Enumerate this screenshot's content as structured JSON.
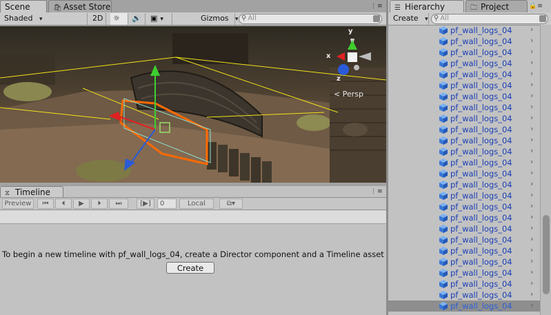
{
  "scene_tabs": {
    "scene": "Scene",
    "asset_store": "Asset Store"
  },
  "scene_toolbar": {
    "shading_mode": "Shaded",
    "view_2d": "2D",
    "gizmos": "Gizmos",
    "search_placeholder": "All"
  },
  "scene_view": {
    "projection_label": "Persp",
    "axis_y": "y",
    "axis_x": "x",
    "axis_z": "z"
  },
  "timeline": {
    "tab_label": "Timeline",
    "preview_label": "Preview",
    "frame_value": "0",
    "time_format": "Local",
    "message": "To begin a new timeline with pf_wall_logs_04, create a Director component and a Timeline asset",
    "create_button": "Create"
  },
  "hierarchy": {
    "tab_label": "Hierarchy",
    "project_tab_label": "Project",
    "create_label": "Create",
    "search_placeholder": "All",
    "items": [
      {
        "label": "pf_wall_logs_04"
      },
      {
        "label": "pf_wall_logs_04"
      },
      {
        "label": "pf_wall_logs_04"
      },
      {
        "label": "pf_wall_logs_04"
      },
      {
        "label": "pf_wall_logs_04"
      },
      {
        "label": "pf_wall_logs_04"
      },
      {
        "label": "pf_wall_logs_04"
      },
      {
        "label": "pf_wall_logs_04"
      },
      {
        "label": "pf_wall_logs_04"
      },
      {
        "label": "pf_wall_logs_04"
      },
      {
        "label": "pf_wall_logs_04"
      },
      {
        "label": "pf_wall_logs_04"
      },
      {
        "label": "pf_wall_logs_04"
      },
      {
        "label": "pf_wall_logs_04"
      },
      {
        "label": "pf_wall_logs_04"
      },
      {
        "label": "pf_wall_logs_04"
      },
      {
        "label": "pf_wall_logs_04"
      },
      {
        "label": "pf_wall_logs_04"
      },
      {
        "label": "pf_wall_logs_04"
      },
      {
        "label": "pf_wall_logs_04"
      },
      {
        "label": "pf_wall_logs_04"
      },
      {
        "label": "pf_wall_logs_04"
      },
      {
        "label": "pf_wall_logs_04"
      },
      {
        "label": "pf_wall_logs_04"
      },
      {
        "label": "pf_wall_logs_04"
      },
      {
        "label": "pf_wall_logs_04",
        "selected": true
      }
    ]
  },
  "colors": {
    "hierarchy_item_text": "#1a3fb5",
    "selection_outline": "#ff6a00",
    "gizmo_y": "#3ecf2e",
    "gizmo_x": "#e02020",
    "gizmo_z": "#2a5bd8"
  }
}
